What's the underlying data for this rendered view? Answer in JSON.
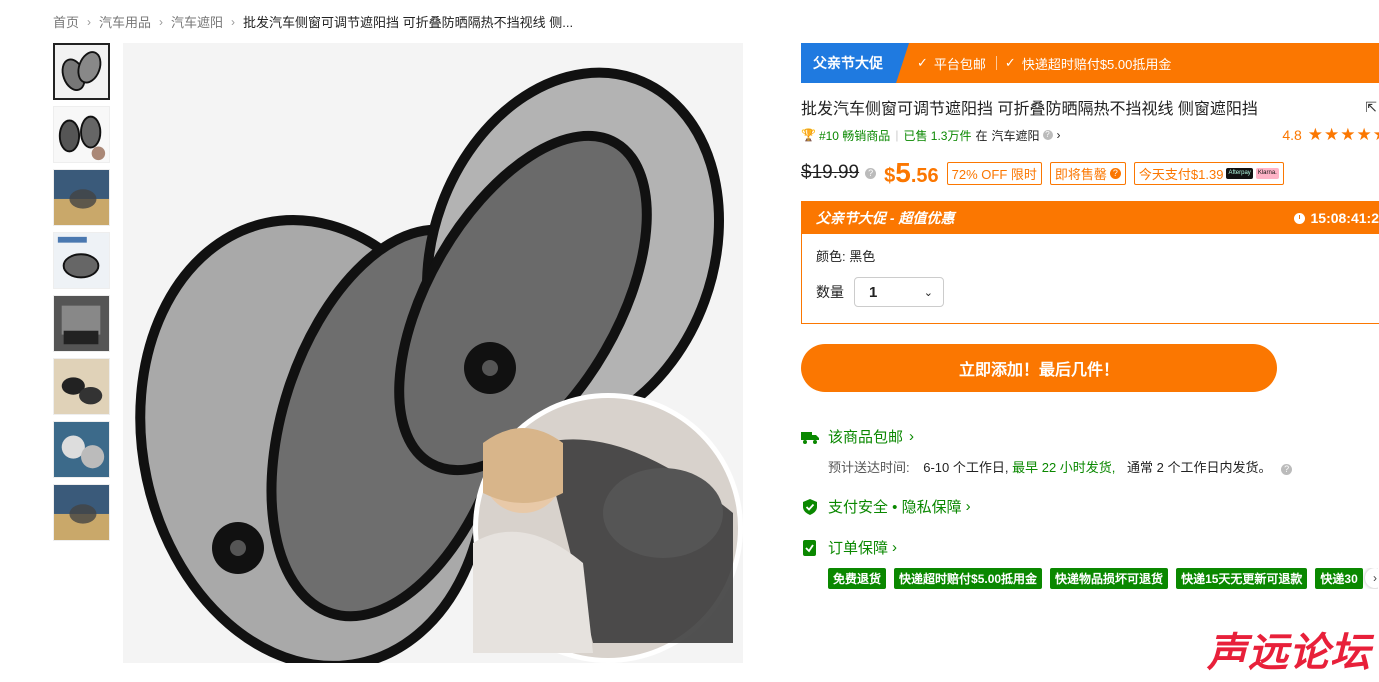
{
  "breadcrumb": {
    "items": [
      "首页",
      "汽车用品",
      "汽车遮阳"
    ],
    "current": "批发汽车侧窗可调节遮阳挡 可折叠防晒隔热不挡视线 侧..."
  },
  "promo": {
    "tag": "父亲节大促",
    "items": [
      "平台包邮",
      "快递超时赔付$5.00抵用金"
    ]
  },
  "product": {
    "title": "批发汽车侧窗可调节遮阳挡 可折叠防晒隔热不挡视线 侧窗遮阳挡",
    "rank": "#10 畅销商品",
    "sold": "已售 1.3万件",
    "category_prefix": "在",
    "category": "汽车遮阳",
    "rating": "4.8",
    "stars": "★★★★★"
  },
  "price": {
    "original": "$19.99",
    "currency": "$",
    "integer": "5",
    "decimal": ".56",
    "discount": "72% OFF 限时",
    "selling_out": "即将售罄",
    "pay_today": "今天支付$1.39",
    "pay_logo_1": "Afterpay",
    "pay_logo_2": "Klarna."
  },
  "deal": {
    "title": "父亲节大促 - 超值优惠",
    "timer": "15:08:41:2",
    "color_label": "颜色:",
    "color_value": "黑色",
    "qty_label": "数量",
    "qty_value": "1"
  },
  "cta": {
    "add_label": "立即添加！最后几件！"
  },
  "service": {
    "shipping": "该商品包邮",
    "delivery_label": "预计送达时间:",
    "delivery_value": "6-10 个工作日,",
    "delivery_fast": "最早 22 小时发货,",
    "delivery_normal": "通常 2 个工作日内发货。",
    "safety": "支付安全 • 隐私保障",
    "guarantee": "订单保障",
    "tags": [
      "免费退货",
      "快递超时赔付$5.00抵用金",
      "快递物品损坏可退货",
      "快递15天无更新可退款",
      "快递30"
    ]
  },
  "watermark": "声远论坛",
  "colors": {
    "accent": "#fb7701",
    "promo_blue": "#1f7ae0",
    "green": "#0a8800"
  }
}
